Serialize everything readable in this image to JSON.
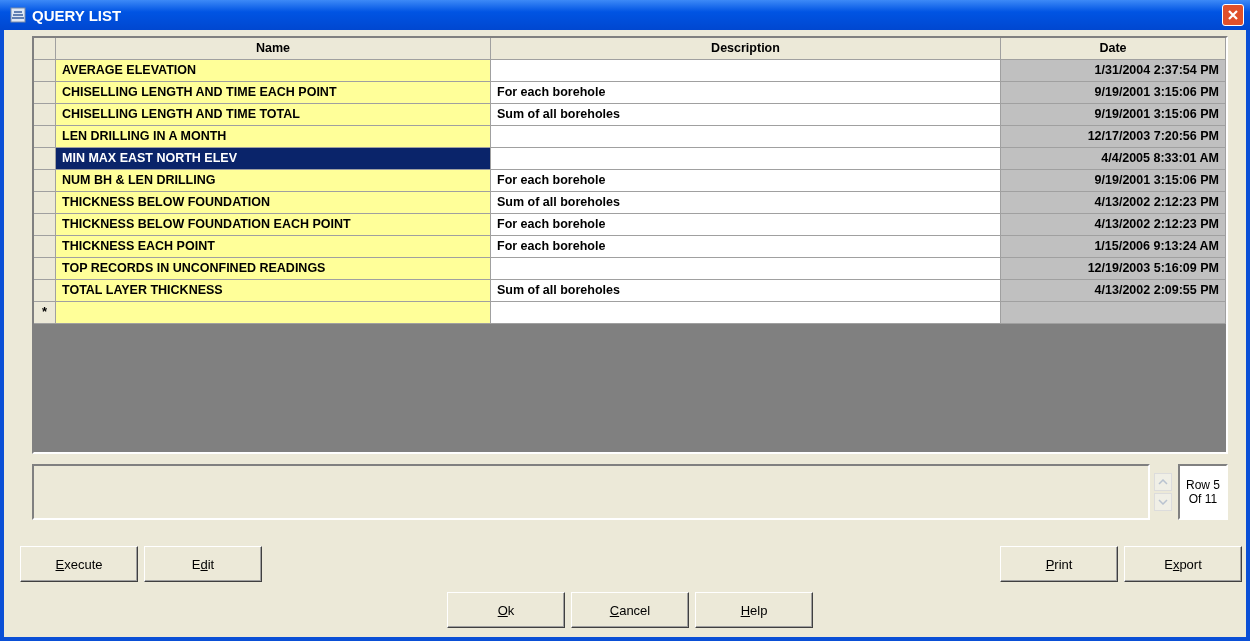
{
  "window": {
    "title": "QUERY LIST"
  },
  "table": {
    "columns": [
      "Name",
      "Description",
      "Date"
    ],
    "rows": [
      {
        "name": "AVERAGE ELEVATION",
        "description": "",
        "date": "1/31/2004 2:37:54 PM",
        "selected": false
      },
      {
        "name": "CHISELLING LENGTH AND TIME EACH POINT",
        "description": "For each borehole",
        "date": "9/19/2001 3:15:06 PM",
        "selected": false
      },
      {
        "name": "CHISELLING LENGTH AND TIME TOTAL",
        "description": "Sum of all boreholes",
        "date": "9/19/2001 3:15:06 PM",
        "selected": false
      },
      {
        "name": "LEN DRILLING IN A MONTH",
        "description": "",
        "date": "12/17/2003 7:20:56 PM",
        "selected": false
      },
      {
        "name": "MIN MAX EAST NORTH ELEV",
        "description": "",
        "date": "4/4/2005 8:33:01 AM",
        "selected": true
      },
      {
        "name": "NUM BH & LEN DRILLING",
        "description": "For each borehole",
        "date": "9/19/2001 3:15:06 PM",
        "selected": false
      },
      {
        "name": "THICKNESS BELOW FOUNDATION",
        "description": "Sum of all boreholes",
        "date": "4/13/2002 2:12:23 PM",
        "selected": false
      },
      {
        "name": "THICKNESS BELOW FOUNDATION EACH POINT",
        "description": "For each borehole",
        "date": "4/13/2002 2:12:23 PM",
        "selected": false
      },
      {
        "name": "THICKNESS EACH POINT",
        "description": "For each borehole",
        "date": "1/15/2006 9:13:24 AM",
        "selected": false
      },
      {
        "name": "TOP RECORDS IN UNCONFINED READINGS",
        "description": "",
        "date": "12/19/2003 5:16:09 PM",
        "selected": false
      },
      {
        "name": "TOTAL LAYER THICKNESS",
        "description": "Sum of all boreholes",
        "date": "4/13/2002 2:09:55 PM",
        "selected": false
      }
    ],
    "new_row_marker": "*"
  },
  "record_counter": [
    "Row 5",
    "Of 11"
  ],
  "left_buttons": [
    {
      "access_key": "E",
      "after": "xecute"
    },
    {
      "before": "E",
      "access_key": "d",
      "after": "it"
    }
  ],
  "right_buttons": [
    {
      "access_key": "P",
      "after": "rint"
    },
    {
      "before": "E",
      "access_key": "x",
      "after": "port"
    }
  ],
  "bottom_buttons": [
    {
      "access_key": "O",
      "after": "k"
    },
    {
      "access_key": "C",
      "after": "ancel"
    },
    {
      "access_key": "H",
      "after": "elp"
    }
  ]
}
